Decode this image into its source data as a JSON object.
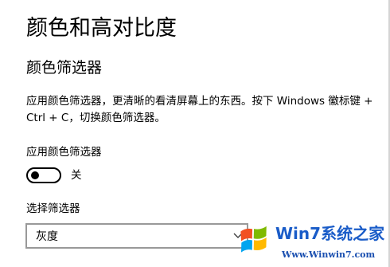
{
  "page": {
    "title": "颜色和高对比度"
  },
  "color_filter": {
    "section_title": "颜色筛选器",
    "description": "应用颜色筛选器，更清晰的看清屏幕上的东西。按下 Windows 徽标键 + Ctrl + C，切换颜色筛选器。",
    "toggle_label": "应用颜色筛选器",
    "toggle_state": "关",
    "toggle_on": false,
    "select_label": "选择筛选器",
    "select_value": "灰度"
  },
  "watermark": {
    "brand": "Win7系统之家",
    "url": "Www.Winwin7.com"
  },
  "colors": {
    "text": "#000000",
    "select_border": "#999999",
    "watermark_blue": "#1a5cc8"
  },
  "icons": {
    "dropdown": "chevron-down-icon",
    "watermark_logo": "windows-logo-icon"
  }
}
